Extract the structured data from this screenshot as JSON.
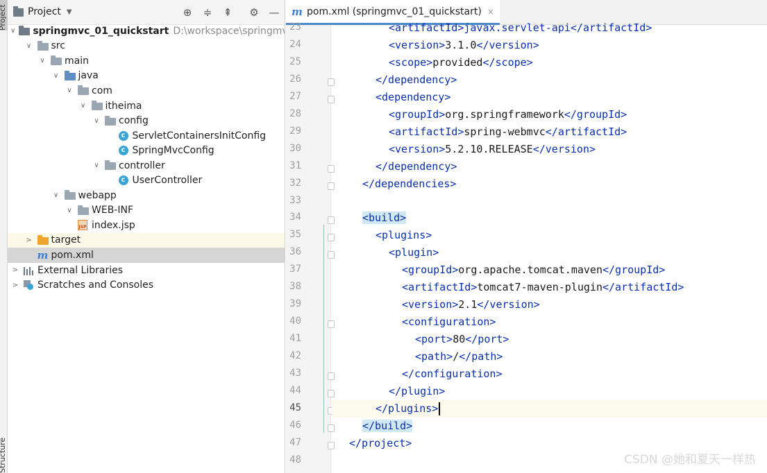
{
  "side_strip": {
    "project_label": "Project",
    "structure_label": "Structure"
  },
  "project_panel": {
    "title": "Project",
    "header_icons": [
      "crosshair-icon",
      "expand-all-icon",
      "collapse-all-icon",
      "gear-icon",
      "minimize-icon"
    ],
    "tree": [
      {
        "label": "springmvc_01_quickstart",
        "hint": "D:\\workspace\\springmvc\\s",
        "depth": 0,
        "arrow": "open",
        "icon": "module-folder"
      },
      {
        "label": "src",
        "depth": 1,
        "arrow": "open",
        "icon": "folder"
      },
      {
        "label": "main",
        "depth": 2,
        "arrow": "open",
        "icon": "folder"
      },
      {
        "label": "java",
        "depth": 3,
        "arrow": "open",
        "icon": "source-folder"
      },
      {
        "label": "com",
        "depth": 4,
        "arrow": "open",
        "icon": "package"
      },
      {
        "label": "itheima",
        "depth": 5,
        "arrow": "open",
        "icon": "package"
      },
      {
        "label": "config",
        "depth": 6,
        "arrow": "open",
        "icon": "package"
      },
      {
        "label": "ServletContainersInitConfig",
        "depth": 7,
        "arrow": "none",
        "icon": "class"
      },
      {
        "label": "SpringMvcConfig",
        "depth": 7,
        "arrow": "none",
        "icon": "class"
      },
      {
        "label": "controller",
        "depth": 6,
        "arrow": "open",
        "icon": "package"
      },
      {
        "label": "UserController",
        "depth": 7,
        "arrow": "none",
        "icon": "class"
      },
      {
        "label": "webapp",
        "depth": 3,
        "arrow": "open",
        "icon": "web-folder"
      },
      {
        "label": "WEB-INF",
        "depth": 4,
        "arrow": "open",
        "icon": "folder"
      },
      {
        "label": "index.jsp",
        "depth": 4,
        "arrow": "none",
        "icon": "jsp-file"
      },
      {
        "label": "target",
        "depth": 1,
        "arrow": "closed",
        "icon": "excluded-folder"
      },
      {
        "label": "pom.xml",
        "depth": 1,
        "arrow": "none",
        "icon": "maven-file"
      },
      {
        "label": "External Libraries",
        "depth": 0,
        "arrow": "closed",
        "icon": "libraries"
      },
      {
        "label": "Scratches and Consoles",
        "depth": 0,
        "arrow": "closed",
        "icon": "scratches"
      }
    ]
  },
  "editor": {
    "tab_label": "pom.xml (springmvc_01_quickstart)",
    "tab_close": "×",
    "current_line": 45,
    "lines": [
      {
        "n": "23",
        "indent": 2,
        "parts": [
          {
            "t": "<artifactId>javax.servlet-api</artifactId>",
            "k": "tag"
          }
        ]
      },
      {
        "n": "24",
        "indent": 2,
        "parts": [
          {
            "t": "<version>",
            "k": "tag"
          },
          {
            "t": "3.1.0",
            "k": "text"
          },
          {
            "t": "</version>",
            "k": "tag"
          }
        ]
      },
      {
        "n": "25",
        "indent": 2,
        "parts": [
          {
            "t": "<scope>",
            "k": "tag"
          },
          {
            "t": "provided",
            "k": "text"
          },
          {
            "t": "</scope>",
            "k": "tag"
          }
        ]
      },
      {
        "n": "26",
        "indent": 1,
        "parts": [
          {
            "t": "</dependency>",
            "k": "tag"
          }
        ]
      },
      {
        "n": "27",
        "indent": 1,
        "parts": [
          {
            "t": "<dependency>",
            "k": "tag"
          }
        ]
      },
      {
        "n": "28",
        "indent": 2,
        "parts": [
          {
            "t": "<groupId>",
            "k": "tag"
          },
          {
            "t": "org.springframework",
            "k": "text"
          },
          {
            "t": "</groupId>",
            "k": "tag"
          }
        ]
      },
      {
        "n": "29",
        "indent": 2,
        "parts": [
          {
            "t": "<artifactId>",
            "k": "tag"
          },
          {
            "t": "spring-webmvc",
            "k": "text"
          },
          {
            "t": "</artifactId>",
            "k": "tag"
          }
        ]
      },
      {
        "n": "30",
        "indent": 2,
        "parts": [
          {
            "t": "<version>",
            "k": "tag"
          },
          {
            "t": "5.2.10.RELEASE",
            "k": "text"
          },
          {
            "t": "</version>",
            "k": "tag"
          }
        ]
      },
      {
        "n": "31",
        "indent": 1,
        "parts": [
          {
            "t": "</dependency>",
            "k": "tag"
          }
        ]
      },
      {
        "n": "32",
        "indent": 0,
        "parts": [
          {
            "t": "</dependencies>",
            "k": "tag"
          }
        ]
      },
      {
        "n": "33",
        "indent": 0,
        "parts": []
      },
      {
        "n": "34",
        "indent": 0,
        "parts": [
          {
            "t": "<build>",
            "k": "tag-hl"
          }
        ]
      },
      {
        "n": "35",
        "indent": 1,
        "parts": [
          {
            "t": "<plugins>",
            "k": "tag"
          }
        ]
      },
      {
        "n": "36",
        "indent": 2,
        "parts": [
          {
            "t": "<plugin>",
            "k": "tag"
          }
        ]
      },
      {
        "n": "37",
        "indent": 3,
        "parts": [
          {
            "t": "<groupId>",
            "k": "tag"
          },
          {
            "t": "org.apache.tomcat.maven",
            "k": "text"
          },
          {
            "t": "</groupId>",
            "k": "tag"
          }
        ]
      },
      {
        "n": "38",
        "indent": 3,
        "parts": [
          {
            "t": "<artifactId>",
            "k": "tag"
          },
          {
            "t": "tomcat7-maven-plugin",
            "k": "text"
          },
          {
            "t": "</artifactId>",
            "k": "tag"
          }
        ]
      },
      {
        "n": "39",
        "indent": 3,
        "parts": [
          {
            "t": "<version>",
            "k": "tag"
          },
          {
            "t": "2.1",
            "k": "text"
          },
          {
            "t": "</version>",
            "k": "tag"
          }
        ]
      },
      {
        "n": "40",
        "indent": 3,
        "parts": [
          {
            "t": "<configuration>",
            "k": "tag"
          }
        ]
      },
      {
        "n": "41",
        "indent": 4,
        "parts": [
          {
            "t": "<port>",
            "k": "tag"
          },
          {
            "t": "80",
            "k": "text"
          },
          {
            "t": "</port>",
            "k": "tag"
          }
        ]
      },
      {
        "n": "42",
        "indent": 4,
        "parts": [
          {
            "t": "<path>",
            "k": "tag"
          },
          {
            "t": "/",
            "k": "text"
          },
          {
            "t": "</path>",
            "k": "tag"
          }
        ]
      },
      {
        "n": "43",
        "indent": 3,
        "parts": [
          {
            "t": "</configuration>",
            "k": "tag"
          }
        ]
      },
      {
        "n": "44",
        "indent": 2,
        "parts": [
          {
            "t": "</plugin>",
            "k": "tag"
          }
        ]
      },
      {
        "n": "45",
        "indent": 1,
        "parts": [
          {
            "t": "</plugins>",
            "k": "tag"
          }
        ]
      },
      {
        "n": "46",
        "indent": 0,
        "parts": [
          {
            "t": "</build>",
            "k": "tag-hl"
          }
        ]
      },
      {
        "n": "47",
        "indent": -1,
        "parts": [
          {
            "t": "</project>",
            "k": "tag"
          }
        ]
      },
      {
        "n": "48",
        "indent": 0,
        "parts": []
      }
    ]
  },
  "watermark": "CSDN @她和夏天一样热",
  "colors": {
    "tag": "#0a2fa8",
    "text": "#1a1a1a",
    "selection": "#d5d5d5",
    "excluded": "#fcf9e8",
    "current_line": "#fcfaed",
    "tab_underline": "#4a88c7"
  }
}
